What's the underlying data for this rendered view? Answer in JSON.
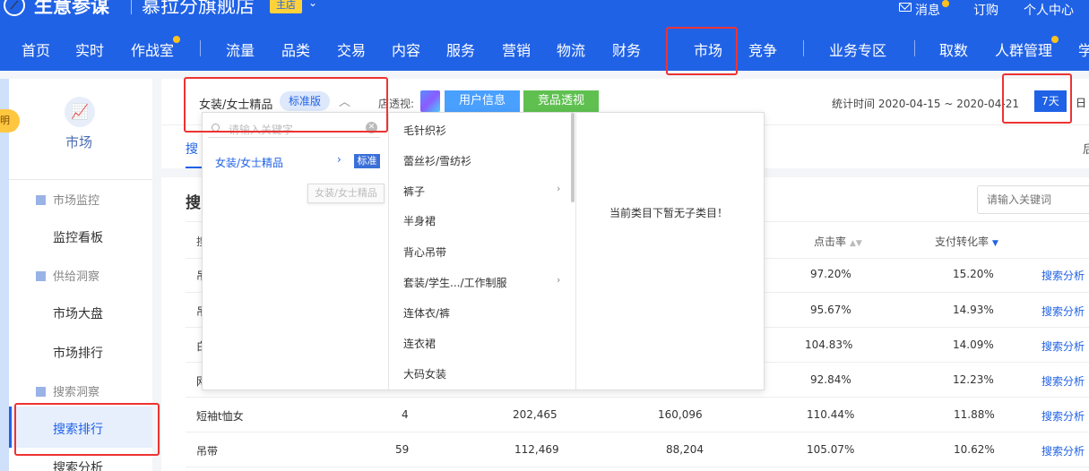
{
  "header": {
    "brand": "生意参谋",
    "shop_name": "慕拉分旗舰店",
    "shop_badge": "主店",
    "links": [
      "消息",
      "订购",
      "个人中心"
    ]
  },
  "nav": {
    "items": [
      "首页",
      "实时",
      "作战室",
      "流量",
      "品类",
      "交易",
      "内容",
      "服务",
      "营销",
      "物流",
      "财务",
      "市场",
      "竞争",
      "业务专区",
      "取数",
      "人群管理",
      "学"
    ],
    "active": "市场"
  },
  "sidebar": {
    "tip": "明",
    "module_title": "市场",
    "sections": [
      {
        "title": "市场监控",
        "items": [
          "监控看板"
        ]
      },
      {
        "title": "供给洞察",
        "items": [
          "市场大盘",
          "市场排行"
        ]
      },
      {
        "title": "搜索洞察",
        "items": [
          "搜索排行",
          "搜索分析"
        ]
      }
    ],
    "active_item": "搜索排行"
  },
  "toolbar": {
    "category": "女装/女士精品",
    "version_badge": "标准版",
    "store_label": "店透视:",
    "btn_user_info": "用户信息",
    "btn_competitor": "竞品透视",
    "stat_time": "统计时间 2020-04-15 ~ 2020-04-21",
    "period_7": "7天",
    "period_day": "日"
  },
  "tabs": {
    "first_fragment": "搜",
    "right_fragment": "后"
  },
  "content": {
    "title_fragment": "搜",
    "search_placeholder": "请输入关键词",
    "headers": {
      "first": "搜",
      "click_rate": "点击率",
      "pay_conversion": "支付转化率"
    },
    "rows": [
      {
        "kw": "吊",
        "rank": "",
        "col3": "",
        "col4": "",
        "click": "97.20%",
        "conv": "15.20%",
        "action": "搜索分析"
      },
      {
        "kw": "吊",
        "rank": "",
        "col3": "",
        "col4": "",
        "click": "95.67%",
        "conv": "14.93%",
        "action": "搜索分析"
      },
      {
        "kw": "白",
        "rank": "",
        "col3": "",
        "col4": "",
        "click": "104.83%",
        "conv": "14.09%",
        "action": "搜索分析"
      },
      {
        "kw": "网",
        "rank": "",
        "col3": "",
        "col4": "",
        "click": "92.84%",
        "conv": "12.23%",
        "action": "搜索分析"
      },
      {
        "kw": "短袖t恤女",
        "rank": "4",
        "col3": "202,465",
        "col4": "160,096",
        "click": "110.44%",
        "conv": "11.88%",
        "action": "搜索分析"
      },
      {
        "kw": "吊带",
        "rank": "59",
        "col3": "112,469",
        "col4": "88,204",
        "click": "105.07%",
        "conv": "10.62%",
        "action": "搜索分析"
      }
    ]
  },
  "dropdown": {
    "search_placeholder": "请输入关键字",
    "level1": "女装/女士精品",
    "level1_badge": "标准",
    "tooltip": "女装/女士精品",
    "subcategories": [
      {
        "label": "毛针织衫",
        "has_children": false
      },
      {
        "label": "蕾丝衫/雪纺衫",
        "has_children": false
      },
      {
        "label": "裤子",
        "has_children": true
      },
      {
        "label": "半身裙",
        "has_children": false
      },
      {
        "label": "背心吊带",
        "has_children": false
      },
      {
        "label": "套装/学生.../工作制服",
        "has_children": true
      },
      {
        "label": "连体衣/裤",
        "has_children": false
      },
      {
        "label": "连衣裙",
        "has_children": false
      },
      {
        "label": "大码女装",
        "has_children": false
      }
    ],
    "empty_message": "当前类目下暂无子类目！"
  },
  "colors": {
    "primary": "#2062e6",
    "highlight_box": "#ee3333",
    "green_button": "#5fc050",
    "blue_button": "#4aa0ff"
  }
}
